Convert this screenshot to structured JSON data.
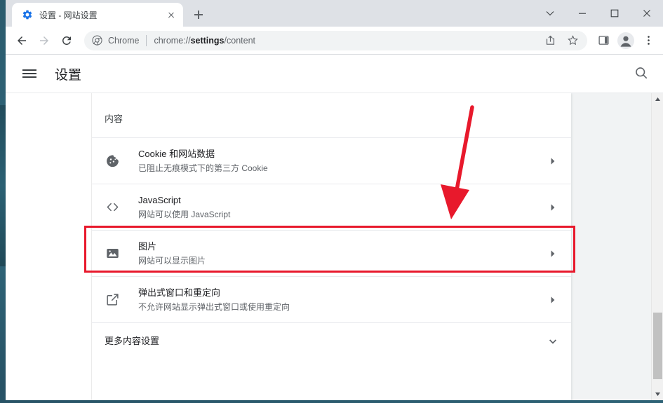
{
  "window": {
    "controls": [
      {
        "name": "tab-search-chevron",
        "glyph": "chevron-down"
      },
      {
        "name": "minimize",
        "glyph": "minimize"
      },
      {
        "name": "maximize",
        "glyph": "maximize"
      },
      {
        "name": "close",
        "glyph": "close"
      }
    ]
  },
  "tabs": [
    {
      "title": "设置 - 网站设置",
      "favicon": "settings-gear-icon",
      "favicon_color": "#1a73e8",
      "active": true
    }
  ],
  "new_tab_label": "+",
  "toolbar": {
    "back_icon": "back-arrow-icon",
    "forward_icon": "forward-arrow-icon",
    "reload_icon": "reload-icon",
    "omnibox": {
      "scheme_chip_icon": "chrome-logo-icon",
      "scheme_chip_label": "Chrome",
      "url_prefix": "chrome://",
      "url_bold": "settings",
      "url_suffix": "/content",
      "full_url": "chrome://settings/content"
    },
    "actions": [
      {
        "name": "share-icon",
        "label": "分享"
      },
      {
        "name": "bookmark-star-icon",
        "label": "收藏"
      },
      {
        "name": "side-panel-icon",
        "label": "侧边栏"
      },
      {
        "name": "profile-avatar-icon",
        "label": "个人资料"
      },
      {
        "name": "more-menu-icon",
        "label": "更多"
      }
    ]
  },
  "settings": {
    "menu_icon": "hamburger-menu-icon",
    "title": "设置",
    "search_icon": "search-icon",
    "section_title": "内容",
    "rows": [
      {
        "icon": "cookie-icon",
        "title": "Cookie 和网站数据",
        "subtitle": "已阻止无痕模式下的第三方 Cookie",
        "arrow": "chevron-right-icon",
        "highlighted": false
      },
      {
        "icon": "code-brackets-icon",
        "title": "JavaScript",
        "subtitle": "网站可以使用 JavaScript",
        "arrow": "chevron-right-icon",
        "highlighted": false
      },
      {
        "icon": "image-icon",
        "title": "图片",
        "subtitle": "网站可以显示图片",
        "arrow": "chevron-right-icon",
        "highlighted": true
      },
      {
        "icon": "popup-redirect-icon",
        "title": "弹出式窗口和重定向",
        "subtitle": "不允许网站显示弹出式窗口或使用重定向",
        "arrow": "chevron-right-icon",
        "highlighted": false
      }
    ],
    "more_row": {
      "title": "更多内容设置",
      "arrow": "chevron-down-icon"
    }
  },
  "annotations": {
    "highlight_color": "#e8192c",
    "arrow_color": "#e8192c",
    "arrow_name": "red-pointer-arrow",
    "highlight_target": "图片"
  },
  "scrollbar": {
    "up_arrow": "scroll-up-arrow-icon",
    "down_arrow": "scroll-down-arrow-icon",
    "thumb": "scroll-thumb"
  }
}
